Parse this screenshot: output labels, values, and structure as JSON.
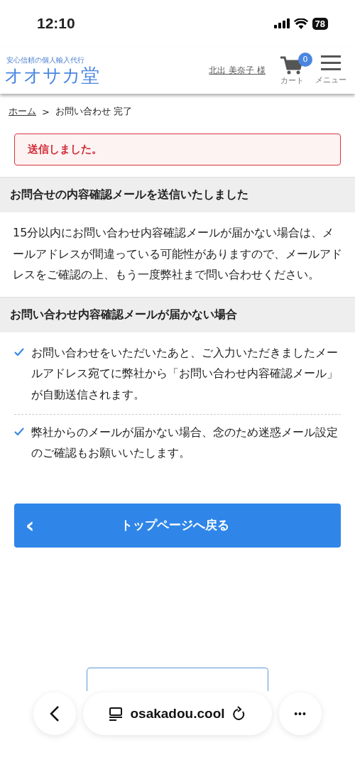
{
  "status_bar": {
    "time": "12:10",
    "battery": "78"
  },
  "header": {
    "tagline": "安心信頼の個人輸入代行",
    "logo": "オオサカ堂",
    "user": "北出 美奈子 様",
    "cart_label": "カート",
    "cart_count": "0",
    "menu_label": "メニュー"
  },
  "breadcrumb": [
    {
      "label": "ホーム",
      "link": true
    },
    {
      "label": "お問い合わせ 完了",
      "link": false
    }
  ],
  "breadcrumb_separator": ">",
  "alert": "送信しました。",
  "sections": [
    {
      "heading": "お問合せの内容確認メールを送信いたしました",
      "kind": "paragraph",
      "text": "15分以内にお問い合わせ内容確認メールが届かない場合は、メールアドレスが間違っている可能性がありますので、メールアドレスをご確認の上、もう一度弊社まで問い合わせください。"
    },
    {
      "heading": "お問い合わせ内容確認メールが届かない場合",
      "kind": "checklist",
      "items": [
        "お問い合わせをいただいたあと、ご入力いただきましたメールアドレス宛てに弊社から「お問い合わせ内容確認メール」が自動送信されます。",
        "弊社からのメールが届かない場合、念のため迷惑メール設定のご確認もお願いいたします。"
      ]
    }
  ],
  "back_button": {
    "icon": "‹",
    "label": "トップページへ戻る"
  },
  "browser_bar": {
    "url": "osakadou.cool",
    "more": "•••"
  }
}
